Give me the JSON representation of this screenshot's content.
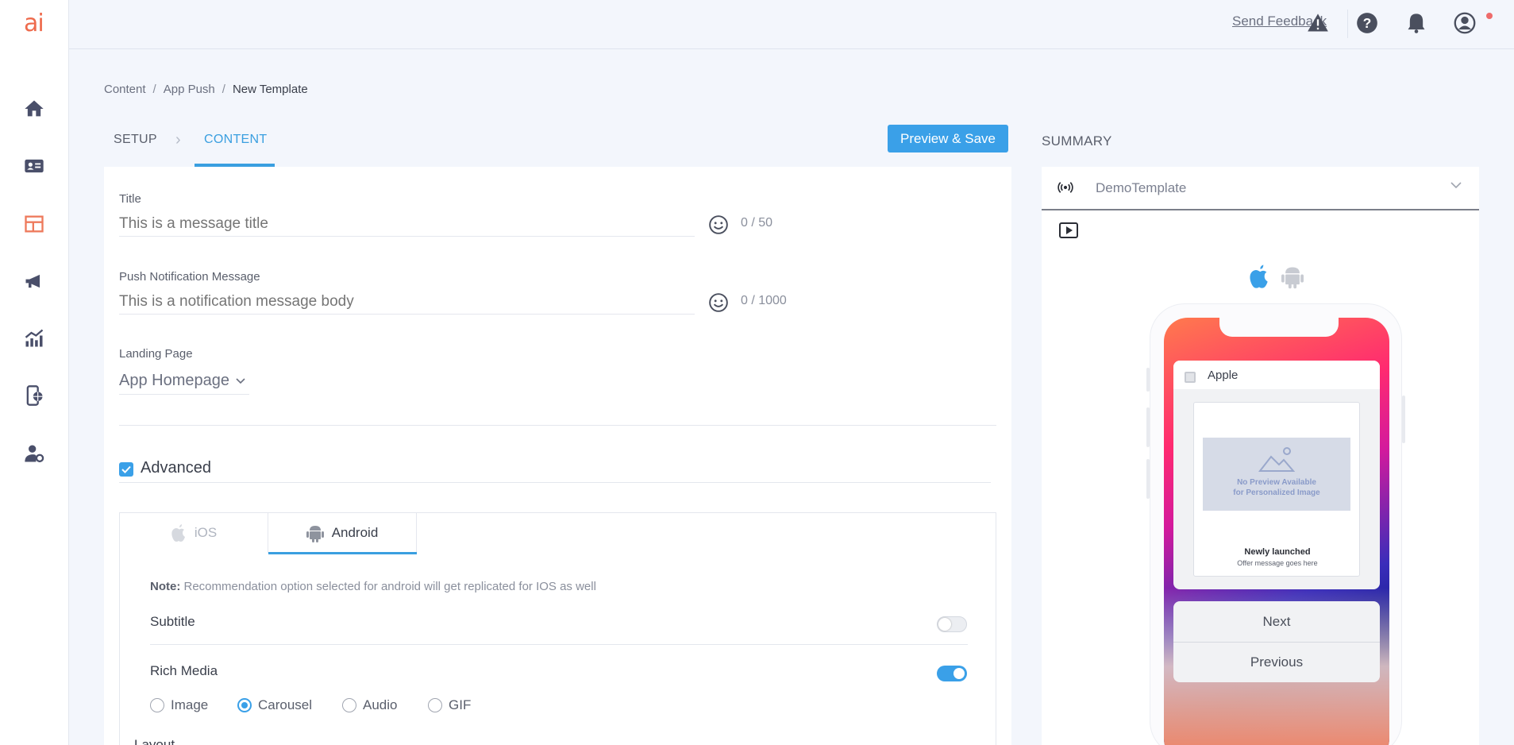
{
  "app": {
    "logo": "ai"
  },
  "sidebar": {
    "items": [
      {
        "icon": "home-icon"
      },
      {
        "icon": "contact-card-icon"
      },
      {
        "icon": "template-icon",
        "active": true
      },
      {
        "icon": "megaphone-icon"
      },
      {
        "icon": "analytics-icon"
      },
      {
        "icon": "mobile-web-icon"
      },
      {
        "icon": "user-settings-icon"
      }
    ]
  },
  "topbar": {
    "feedback": "Send Feedback",
    "icons": [
      "alert-icon",
      "help-icon",
      "bell-icon",
      "account-icon"
    ]
  },
  "breadcrumb": {
    "items": [
      "Content",
      "App Push",
      "New Template"
    ]
  },
  "steps": {
    "setup": "SETUP",
    "content": "CONTENT",
    "preview_save": "Preview & Save"
  },
  "form": {
    "title": {
      "label": "Title",
      "placeholder": "This is a message title",
      "counter": "0 / 50"
    },
    "message": {
      "label": "Push Notification Message",
      "placeholder": "This is a notification message body",
      "counter": "0 / 1000"
    },
    "landing": {
      "label": "Landing Page",
      "value": "App Homepage"
    },
    "advanced": {
      "label": "Advanced",
      "checked": true
    },
    "os_tabs": {
      "ios": "iOS",
      "android": "Android",
      "active": "android"
    },
    "note_label": "Note:",
    "note_text": " Recommendation option selected for android will get replicated for IOS as well",
    "subtitle": {
      "label": "Subtitle",
      "enabled": false
    },
    "rich_media": {
      "label": "Rich Media",
      "enabled": true,
      "options": [
        "Image",
        "Carousel",
        "Audio",
        "GIF"
      ],
      "selected": "Carousel"
    },
    "layout_label": "Layout"
  },
  "summary": {
    "title": "SUMMARY",
    "template_name": "DemoTemplate",
    "preview": {
      "app_name": "Apple",
      "no_preview_line1": "No Preview Available",
      "no_preview_line2": "for Personalized Image",
      "rich_title": "Newly launched",
      "rich_subtitle": "Offer message goes here",
      "actions": [
        "Next",
        "Previous"
      ]
    }
  },
  "colors": {
    "accent": "#3aa0e8",
    "brand": "#ee6b4d",
    "background": "#f3f6fc"
  }
}
